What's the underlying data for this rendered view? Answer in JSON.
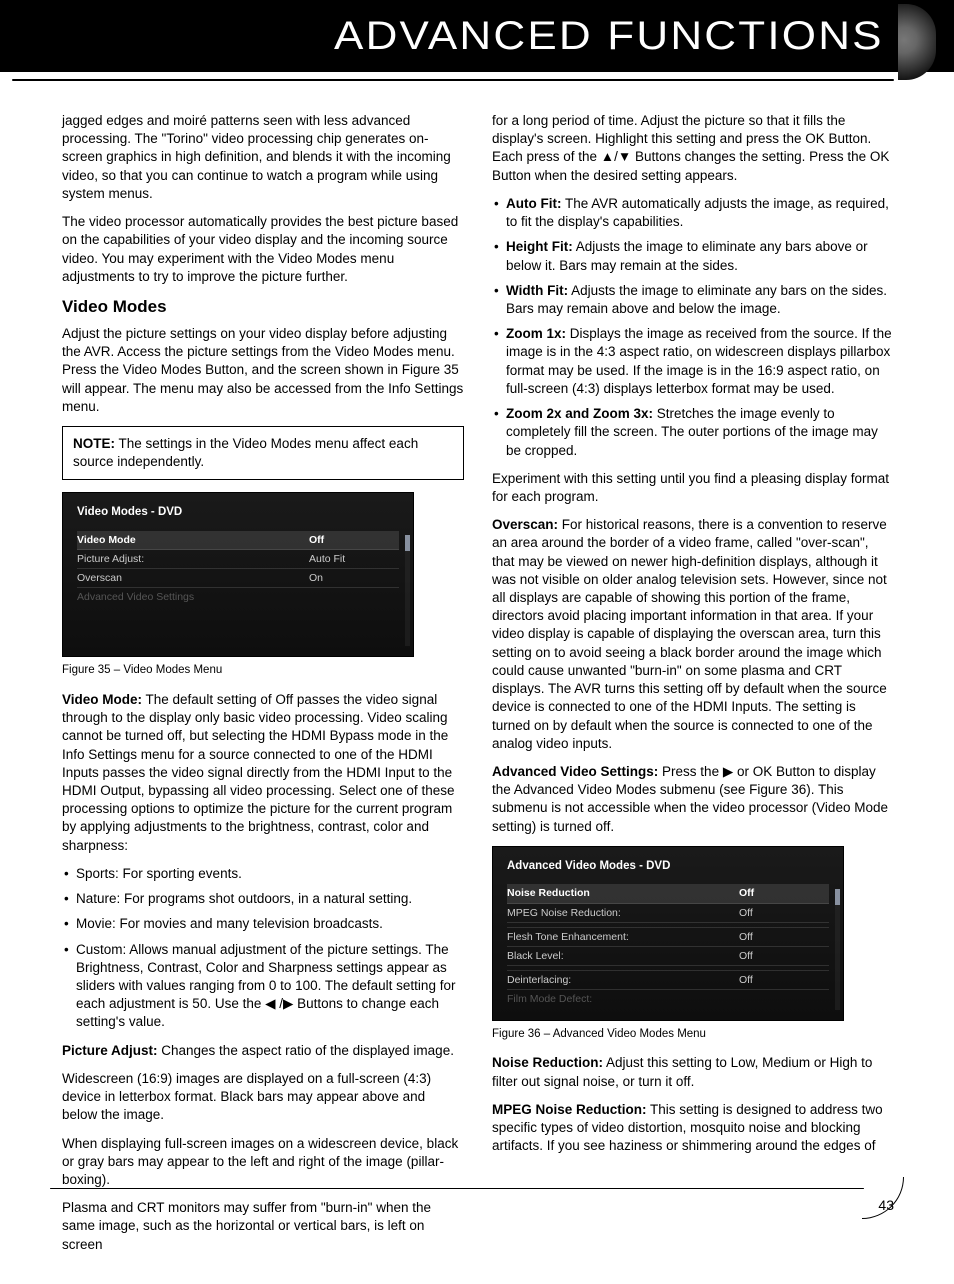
{
  "header": {
    "title": "ADVANCED FUNCTIONS"
  },
  "page_number": "43",
  "left": {
    "p1": "jagged edges and moiré patterns seen with less advanced processing. The \"Torino\" video processing chip generates on-screen graphics in high definition, and blends it with the incoming video, so that you can continue to watch a program while using system menus.",
    "p2": "The video processor automatically provides the best picture based on the capabilities of your video display and the incoming source video. You may experiment with the Video Modes menu adjustments to try to improve the picture further.",
    "video_modes_heading": "Video Modes",
    "p3": "Adjust the picture settings on your video display before adjusting the AVR. Access the picture settings from the Video Modes menu. Press the Video Modes Button, and the screen shown in Figure 35 will appear. The menu may also be accessed from the Info Settings menu.",
    "note_label": "NOTE:",
    "note_body": " The settings in the Video Modes menu affect each source independently.",
    "fig35": {
      "title": "Video Modes - DVD",
      "rows": [
        {
          "k": "Video Mode",
          "v": "Off",
          "sel": true
        },
        {
          "k": "Picture Adjust:",
          "v": "Auto Fit"
        },
        {
          "k": "Overscan",
          "v": "On"
        },
        {
          "k": "Advanced Video Settings",
          "v": "",
          "dim": true
        }
      ],
      "caption": "Figure 35 – Video Modes Menu"
    },
    "video_mode_lead": "Video Mode:",
    "video_mode_body": " The default setting of Off passes the video signal through to the display only basic video processing. Video scaling cannot be turned off, but selecting the HDMI Bypass mode in the Info Settings menu for a source connected to one of the HDMI Inputs passes the video signal directly from the HDMI Input to the HDMI Output, bypassing all video processing. Select one of these processing options to optimize the picture for the current program by applying adjustments to the brightness, contrast, color and sharpness:",
    "mode_items": [
      "Sports: For sporting events.",
      "Nature: For programs shot outdoors, in a natural setting.",
      "Movie: For movies and many television broadcasts.",
      "Custom: Allows manual adjustment of the picture settings. The Brightness, Contrast, Color and Sharpness settings appear as sliders with values ranging from 0 to 100. The default setting for each adjustment is 50. Use the ◀ /▶ Buttons to change each setting's value."
    ],
    "picture_adjust_lead": "Picture Adjust:",
    "picture_adjust_body": " Changes the aspect ratio of the displayed image.",
    "pa_p1": "Widescreen (16:9) images are displayed on a full-screen (4:3) device in letterbox format. Black bars may appear above and below the image.",
    "pa_p2": "When displaying full-screen images on a widescreen device, black or gray bars may appear to the left and right of the image (pillar-boxing).",
    "pa_p3": "Plasma and CRT monitors may suffer from \"burn-in\" when the same image, such as the horizontal or vertical bars, is left on screen"
  },
  "right": {
    "p1": "for a long period of time. Adjust the picture so that it fills the display's screen. Highlight this setting and press the OK Button. Each press of the ▲/▼ Buttons changes the setting. Press the OK Button when the desired setting appears.",
    "fit_items": [
      {
        "lead": "Auto Fit:",
        "body": " The AVR automatically adjusts the image, as required, to fit the display's capabilities."
      },
      {
        "lead": "Height Fit:",
        "body": " Adjusts the image to eliminate any bars above or below it. Bars may remain at the sides."
      },
      {
        "lead": "Width Fit:",
        "body": " Adjusts the image to eliminate any bars on the sides. Bars may remain above and below the image."
      },
      {
        "lead": "Zoom 1x:",
        "body": " Displays the image as received from the source. If the image is in the 4:3 aspect ratio, on widescreen displays pillarbox format may be used. If the image is in the 16:9 aspect ratio, on full-screen (4:3) displays letterbox format may be used."
      },
      {
        "lead": "Zoom 2x and Zoom 3x:",
        "body": " Stretches the image evenly to completely fill the screen. The outer portions of the image may be cropped."
      }
    ],
    "p2": "Experiment with this setting until you find a pleasing display format for each program.",
    "overscan_lead": "Overscan:",
    "overscan_body": " For historical reasons, there is a convention to reserve an area around the border of a video frame, called \"over-scan\", that may be viewed on newer high-definition displays, although it was not visible on older analog television sets. However, since not all displays are capable of showing this portion of the frame, directors avoid placing important information in that area. If your video display is capable of displaying the overscan area, turn this setting on to avoid seeing a black border around the image which could cause unwanted \"burn-in\" on some plasma and CRT displays. The AVR turns this setting off by default when the source device is connected to one of the HDMI Inputs. The setting is turned on by default when the source is connected to one of the analog video inputs.",
    "avs_lead": "Advanced Video Settings:",
    "avs_body": " Press the ▶ or OK Button to display the Advanced Video Modes submenu (see Figure 36). This submenu is not accessible when the video processor (Video Mode setting) is turned off.",
    "fig36": {
      "title": "Advanced Video Modes - DVD",
      "rows": [
        {
          "k": "Noise Reduction",
          "v": "Off",
          "sel": true
        },
        {
          "k": "MPEG Noise Reduction:",
          "v": "Off"
        },
        {
          "k": "",
          "v": ""
        },
        {
          "k": "Flesh Tone Enhancement:",
          "v": "Off"
        },
        {
          "k": "Black Level:",
          "v": "Off"
        },
        {
          "k": "",
          "v": ""
        },
        {
          "k": "Deinterlacing:",
          "v": "Off"
        },
        {
          "k": "Film Mode Defect:",
          "v": "",
          "dim": true
        }
      ],
      "caption": "Figure 36 – Advanced Video Modes Menu"
    },
    "nr_lead": "Noise Reduction:",
    "nr_body": " Adjust this setting to Low, Medium or High to filter out signal noise, or turn it off.",
    "mpeg_lead": "MPEG Noise Reduction:",
    "mpeg_body": " This setting is designed to address two specific types of video distortion, mosquito noise and blocking artifacts. If you see haziness or shimmering around the edges of"
  }
}
